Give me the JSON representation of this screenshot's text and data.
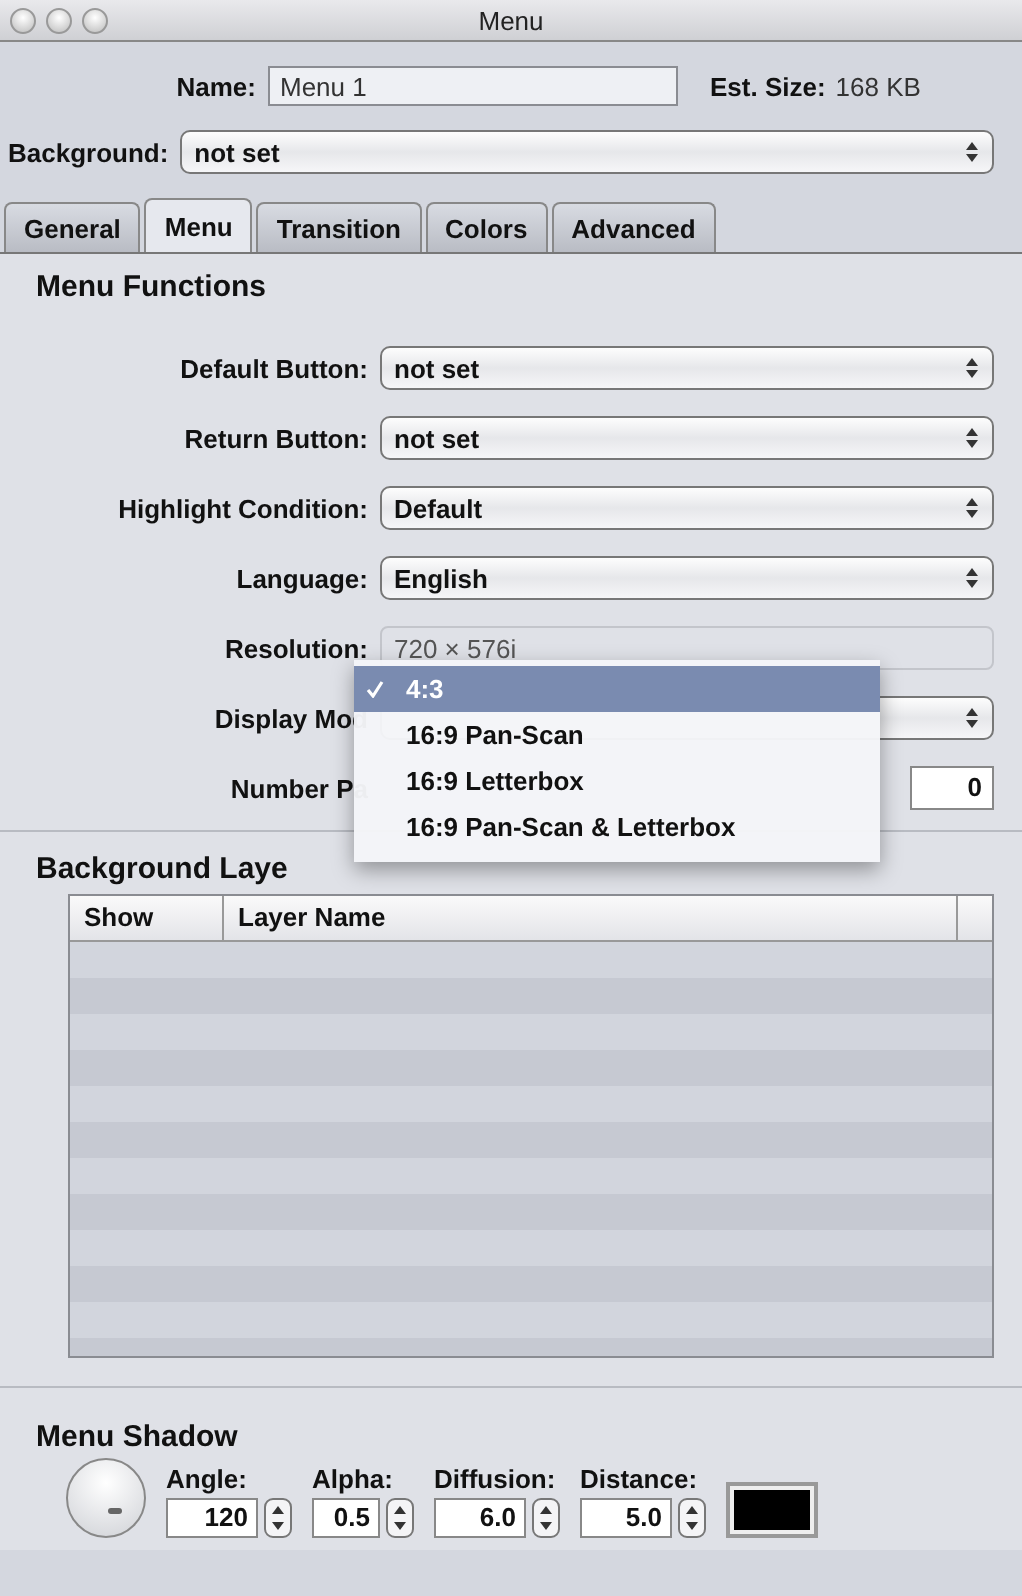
{
  "window": {
    "title": "Menu"
  },
  "name": {
    "label": "Name:",
    "value": "Menu 1"
  },
  "est_size": {
    "label": "Est. Size:",
    "value": "168 KB"
  },
  "background": {
    "label": "Background:",
    "value": "not set"
  },
  "tabs": [
    {
      "label": "General",
      "selected": false
    },
    {
      "label": "Menu",
      "selected": true
    },
    {
      "label": "Transition",
      "selected": false
    },
    {
      "label": "Colors",
      "selected": false
    },
    {
      "label": "Advanced",
      "selected": false
    }
  ],
  "menu_functions": {
    "title": "Menu Functions",
    "rows": [
      {
        "kind": "popup",
        "label": "Default Button:",
        "value": "not set"
      },
      {
        "kind": "popup",
        "label": "Return Button:",
        "value": "not set"
      },
      {
        "kind": "popup",
        "label": "Highlight Condition:",
        "value": "Default"
      },
      {
        "kind": "popup",
        "label": "Language:",
        "value": "English"
      },
      {
        "kind": "readonly",
        "label": "Resolution:",
        "value": "720 × 576i"
      },
      {
        "kind": "open_popup",
        "label": "Display Mod"
      },
      {
        "kind": "offset",
        "label": "Number Pa",
        "value": "0"
      }
    ]
  },
  "popup_menu": {
    "items": [
      {
        "label": "4:3",
        "selected": true
      },
      {
        "label": "16:9 Pan-Scan",
        "selected": false
      },
      {
        "label": "16:9 Letterbox",
        "selected": false
      },
      {
        "label": "16:9 Pan-Scan & Letterbox",
        "selected": false
      }
    ]
  },
  "background_layers": {
    "title": "Background Laye",
    "columns": [
      "Show",
      "Layer Name"
    ]
  },
  "menu_shadow": {
    "title": "Menu Shadow",
    "fields": [
      {
        "label": "Angle:",
        "value": "120"
      },
      {
        "label": "Alpha:",
        "value": "0.5"
      },
      {
        "label": "Diffusion:",
        "value": "6.0"
      },
      {
        "label": "Distance:",
        "value": "5.0"
      }
    ],
    "color": "#000000"
  }
}
